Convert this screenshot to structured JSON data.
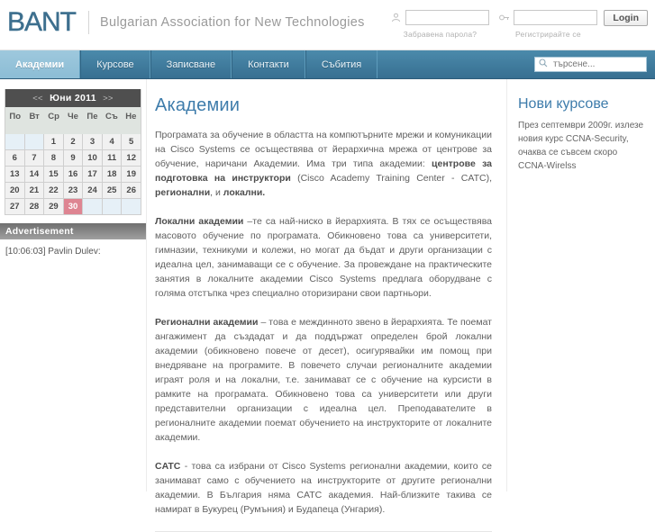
{
  "header": {
    "logo_text": "BANT",
    "tagline": "Bulgarian Association for New Technologies",
    "login": {
      "username_value": "",
      "username_placeholder": "",
      "password_value": "",
      "password_placeholder": "",
      "forgot_password_label": "Забравена парола?",
      "register_label": "Регистрирайте се",
      "login_button_label": "Login",
      "user_icon": "user-icon",
      "key_icon": "key-icon"
    }
  },
  "nav": {
    "tabs": [
      {
        "label": "Академии",
        "active": true
      },
      {
        "label": "Курсове",
        "active": false
      },
      {
        "label": "Записване",
        "active": false
      },
      {
        "label": "Контакти",
        "active": false
      },
      {
        "label": "Събития",
        "active": false
      }
    ],
    "search": {
      "placeholder": "търсене...",
      "value": "",
      "icon": "search-icon"
    }
  },
  "sidebar_left": {
    "calendar": {
      "prev_label": "<<",
      "next_label": ">>",
      "month_label": "Юни 2011",
      "day_headers": [
        "По",
        "Вт",
        "Ср",
        "Че",
        "Пе",
        "Съ",
        "Не"
      ],
      "leading_blanks": 2,
      "days": [
        1,
        2,
        3,
        4,
        5,
        6,
        7,
        8,
        9,
        10,
        11,
        12,
        13,
        14,
        15,
        16,
        17,
        18,
        19,
        20,
        21,
        22,
        23,
        24,
        25,
        26,
        27,
        28,
        29,
        30
      ],
      "trailing_blanks": 3,
      "today": 30,
      "today_color": "#de8592"
    },
    "advertisement": {
      "title": "Advertisement",
      "body_text": "[10:06:03] Pavlin Dulev:"
    }
  },
  "main": {
    "title": "Академии",
    "paragraphs": [
      {
        "id": "p1",
        "parts": [
          {
            "text": "Програмата за обучение в областта на компютърните мрежи и комуникации на Cisco Systems се осъществява от йерархична мрежа от центрове за обучение, наричани Академии. Има три типа академии:  ",
            "bold": false
          },
          {
            "text": "центрове за подготовка на инструктори",
            "bold": true
          },
          {
            "text": "  (Cisco Academy Training Center - CATC), ",
            "bold": false
          },
          {
            "text": "регионални",
            "bold": true
          },
          {
            "text": ", и ",
            "bold": false
          },
          {
            "text": "локални.",
            "bold": true
          }
        ]
      },
      {
        "id": "p2",
        "parts": [
          {
            "text": "Локални академии",
            "bold": true
          },
          {
            "text": " –те са най-ниско в йерархията. В тях се осъществява масовото обучение по програмата. Обикновено това са университети, гимназии, техникуми и колежи, но могат да бъдат и други организации с идеална цел, занимаващи се с обучение. За провеждане на практическите занятия в локалните академии  Cisco Systems предлага оборудване с голяма отстъпка чрез специално оторизирани свои партньори.",
            "bold": false
          }
        ]
      },
      {
        "id": "p3",
        "parts": [
          {
            "text": "Регионални академии",
            "bold": true
          },
          {
            "text": " – това е междинното звено в йерархията. Те поемат ангажимент да създадат и да поддържат определен брой локални академии (обикновено повече от десет), осигурявайки им помощ при внедряване на програмите. В повечето случаи регионалните академии играят роля и на локални, т.е. занимават се с обучение на курсисти в рамките на програмата. Обикновено това са университети или други представителни организации с идеална цел. Преподавателите в регионалните академии поемат обучението на инструкторите от локалните академии.",
            "bold": false
          }
        ]
      },
      {
        "id": "p4",
        "parts": [
          {
            "text": "CATC",
            "bold": true
          },
          {
            "text": " - това са избрани от Cisco Systems регионални академии, които се занимават само с обучението на инструкторите от другите регионални академии. В България няма CATC академия. Най-близките такива се намират в Букурец (Румъния) и Будапеца (Унгария).",
            "bold": false
          }
        ]
      }
    ]
  },
  "sidebar_right": {
    "title": "Нови курсове",
    "text": "През септември 2009г. излезе новия курс CCNA-Security, очаква се съвсем скоро CCNA-Wirelss"
  },
  "colors": {
    "brand_blue": "#3d6f8e",
    "link_blue": "#3e7cab",
    "nav_top": "#4b8aab",
    "nav_bottom": "#376f91",
    "active_tab": "#9ec8dd"
  }
}
